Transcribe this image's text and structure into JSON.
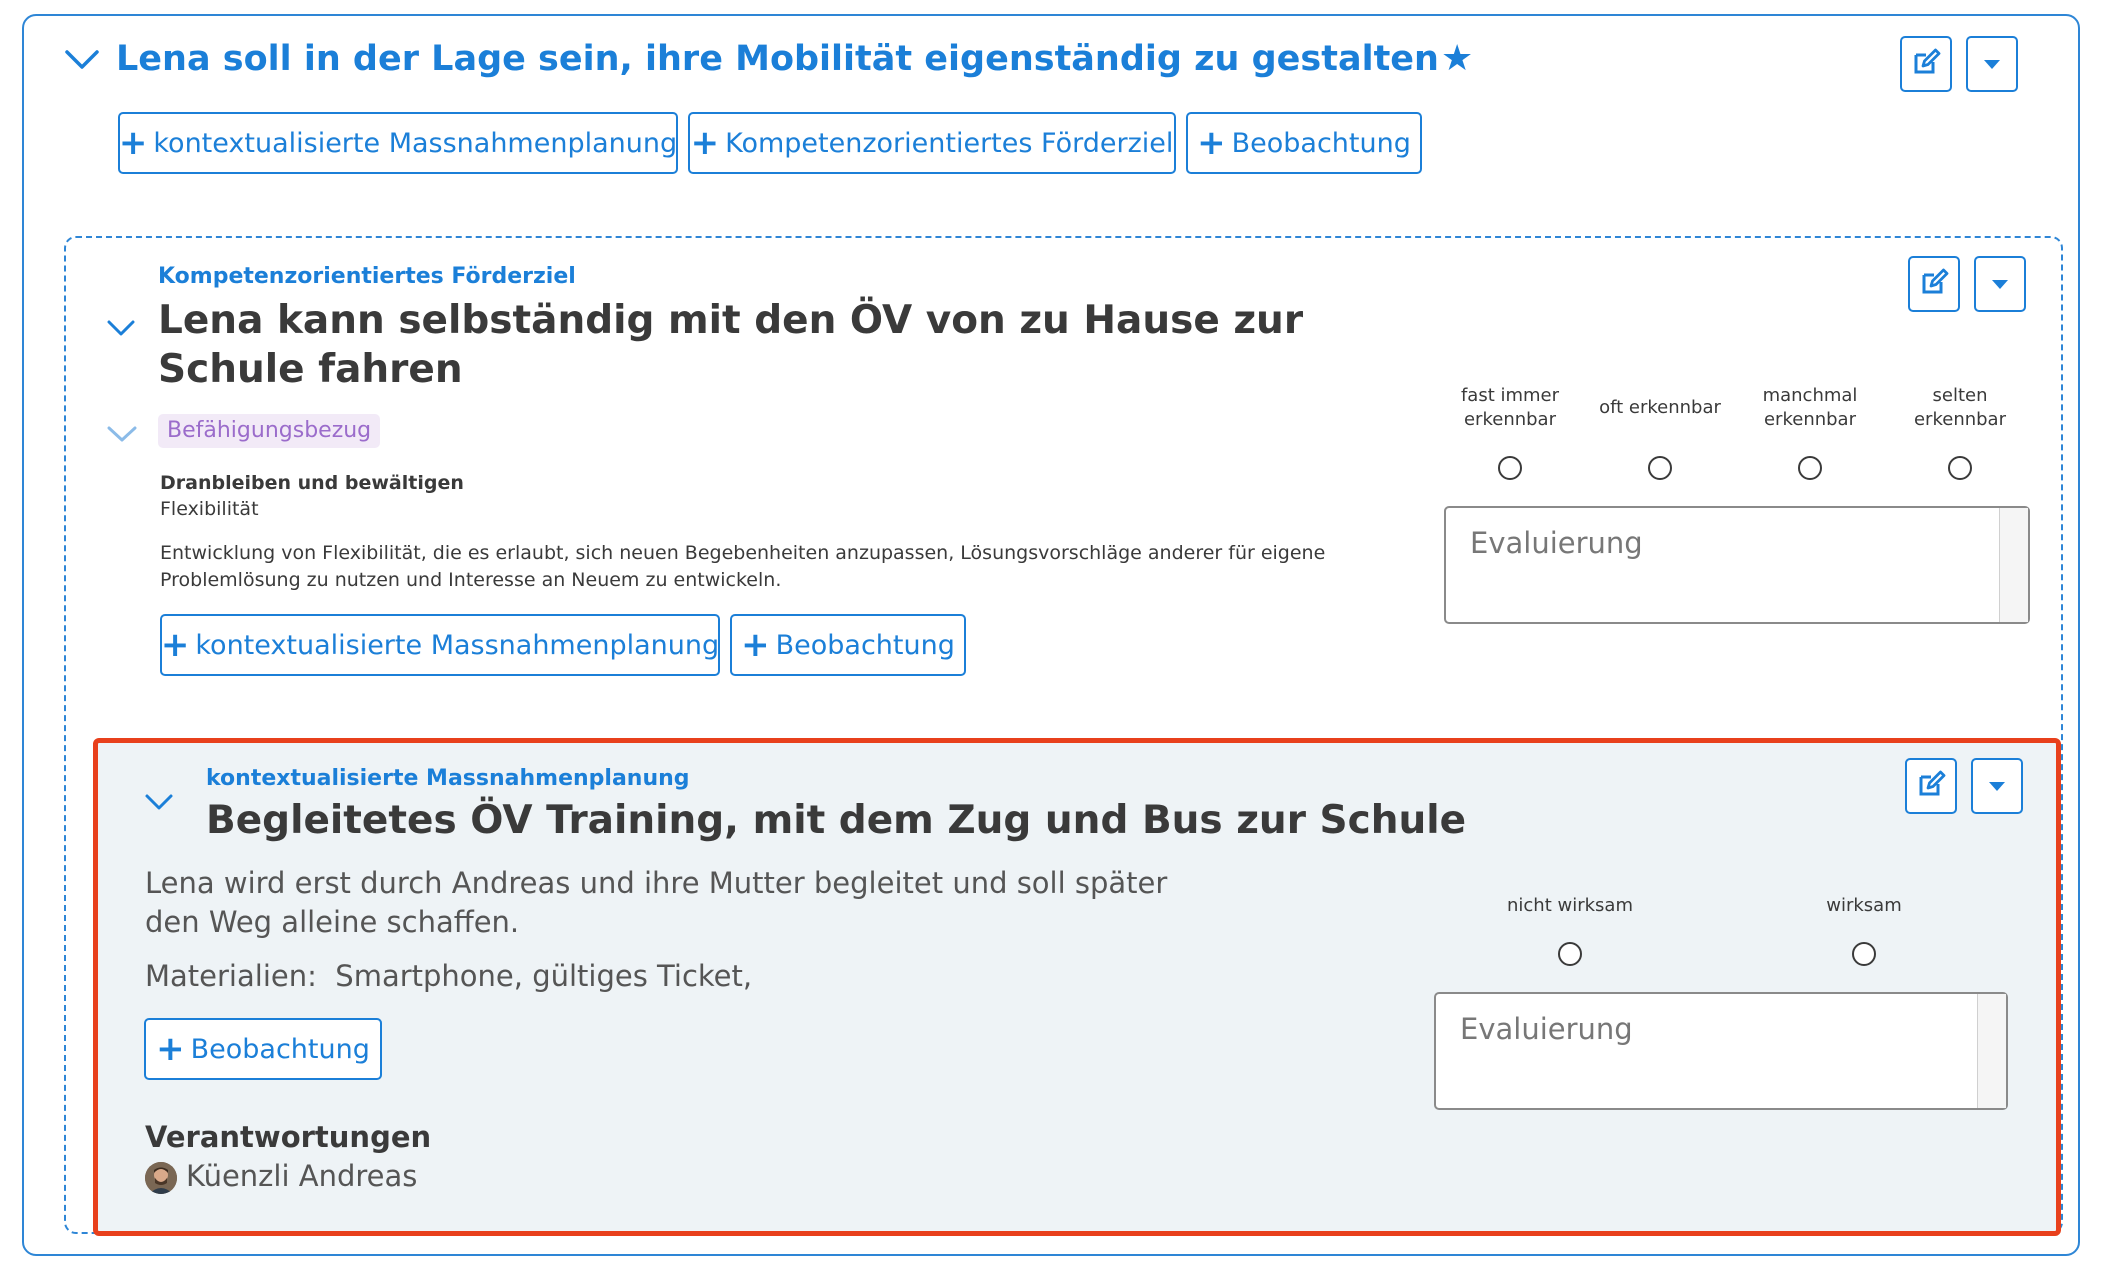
{
  "goal": {
    "title": "Lena soll in der Lage sein, ihre Mobilität eigenständig zu gestalten",
    "add_buttons": [
      "kontextualisierte Massnahmenplanung",
      "Kompetenzorientiertes Förderziel",
      "Beobachtung"
    ]
  },
  "target": {
    "type_label": "Kompetenzorientiertes Förderziel",
    "title": "Lena kann selbständig mit den ÖV von zu Hause zur Schule fahren",
    "chip": "Befähigungsbezug",
    "competence_area": "Dranbleiben und bewältigen",
    "competence": "Flexibilität",
    "description": "Entwicklung von Flexibilität, die es erlaubt, sich neuen Begebenheiten anzupassen, Lösungsvorschläge anderer für eigene Problemlösung zu nutzen und Interesse an Neuem zu entwickeln.",
    "add_buttons": [
      "kontextualisierte Massnahmenplanung",
      "Beobachtung"
    ],
    "scale": [
      [
        "fast immer",
        "erkennbar"
      ],
      [
        "oft erkennbar",
        ""
      ],
      [
        "manchmal",
        "erkennbar"
      ],
      [
        "selten",
        "erkennbar"
      ]
    ],
    "evaluation_placeholder": "Evaluierung"
  },
  "measure": {
    "type_label": "kontextualisierte Massnahmenplanung",
    "title": "Begleitetes ÖV Training, mit dem Zug und Bus zur Schule",
    "description_line1": "Lena wird erst durch Andreas und ihre Mutter begleitet und soll später",
    "description_line2": "den Weg alleine schaffen.",
    "materials": "Materialien:  Smartphone, gültiges Ticket,",
    "add_button": "Beobachtung",
    "scale": [
      "nicht wirksam",
      "wirksam"
    ],
    "evaluation_placeholder": "Evaluierung",
    "responsibilities_heading": "Verantwortungen",
    "responsible_person": "Küenzli Andreas"
  },
  "colors": {
    "accent": "#1b7fd8",
    "highlight_border": "#e8401c",
    "chip_bg": "#f2eaf7",
    "chip_text": "#9b6ccb",
    "measure_bg": "#eef3f6"
  },
  "icons": [
    "chevron-down-icon",
    "star-icon",
    "plus-icon",
    "edit-icon",
    "caret-down-icon"
  ]
}
